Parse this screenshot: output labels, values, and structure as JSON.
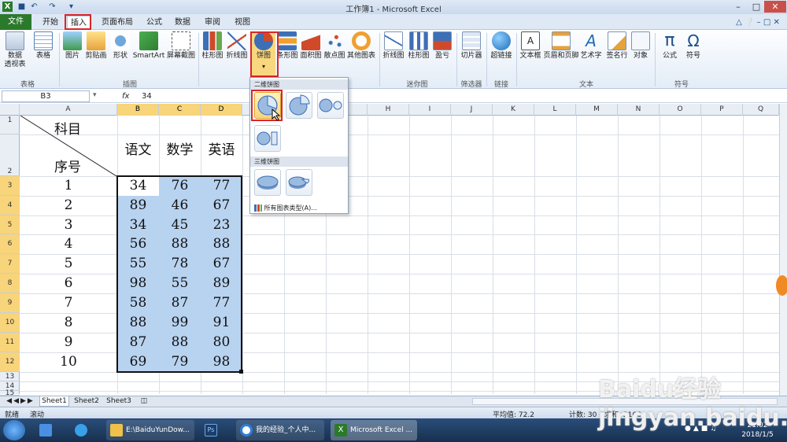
{
  "window": {
    "title": "工作簿1 - Microsoft Excel"
  },
  "tabs": {
    "file": "文件",
    "items": [
      "开始",
      "插入",
      "页面布局",
      "公式",
      "数据",
      "审阅",
      "视图"
    ]
  },
  "ribbon": {
    "buttons": [
      "数据\n透视表",
      "表格",
      "图片",
      "剪贴画",
      "形状",
      "SmartArt",
      "屏幕截图",
      "柱形图",
      "折线图",
      "饼图",
      "条形图",
      "面积图",
      "散点图",
      "其他图表",
      "折线图",
      "柱形图",
      "盈亏",
      "切片器",
      "超链接",
      "文本框",
      "页眉和页脚",
      "艺术字",
      "签名行",
      "对象",
      "公式",
      "符号"
    ],
    "groups": [
      "表格",
      "插图",
      "迷你图",
      "筛选器",
      "链接",
      "文本",
      "符号"
    ]
  },
  "formula_bar": {
    "name_box": "B3",
    "fx": "fx",
    "value": "34"
  },
  "columns": [
    "A",
    "B",
    "C",
    "D",
    "E",
    "F",
    "G",
    "H",
    "I",
    "J",
    "K",
    "L",
    "M",
    "N",
    "O",
    "P",
    "Q"
  ],
  "rows": [
    "1",
    "2",
    "3",
    "4",
    "5",
    "6",
    "7",
    "8",
    "9",
    "10",
    "11",
    "12",
    "13",
    "14",
    "15"
  ],
  "sheet": {
    "header_subject": "科目",
    "header_seq": "序号",
    "col_headers": [
      "语文",
      "数学",
      "英语"
    ],
    "row_ids": [
      "1",
      "2",
      "3",
      "4",
      "5",
      "6",
      "7",
      "8",
      "9",
      "10"
    ],
    "data": [
      [
        "34",
        "76",
        "77"
      ],
      [
        "89",
        "46",
        "67"
      ],
      [
        "34",
        "45",
        "23"
      ],
      [
        "56",
        "88",
        "88"
      ],
      [
        "55",
        "78",
        "67"
      ],
      [
        "98",
        "55",
        "89"
      ],
      [
        "58",
        "87",
        "77"
      ],
      [
        "88",
        "99",
        "91"
      ],
      [
        "87",
        "88",
        "80"
      ],
      [
        "69",
        "79",
        "98"
      ]
    ]
  },
  "dropdown": {
    "section_2d": "二维饼图",
    "section_3d": "三维饼图",
    "all_types": "所有图表类型(A)..."
  },
  "sheet_tabs": [
    "Sheet1",
    "Sheet2",
    "Sheet3"
  ],
  "status": {
    "mode1": "就绪",
    "mode2": "滚动",
    "average": "平均值: 72.2",
    "count": "计数: 30",
    "sum": "求和: 2166"
  },
  "taskbar": {
    "items": [
      "E:\\BaiduYunDow...",
      "我的经验_个人中...",
      "Microsoft Excel ..."
    ],
    "time": "21:02",
    "date": "2018/1/5"
  },
  "watermark": "Baidu经验 jingyan.baidu.com",
  "colors": {
    "accent_red": "#d9262b",
    "selection_fill": "#b8d3f0",
    "file_tab": "#2b7a2b"
  }
}
